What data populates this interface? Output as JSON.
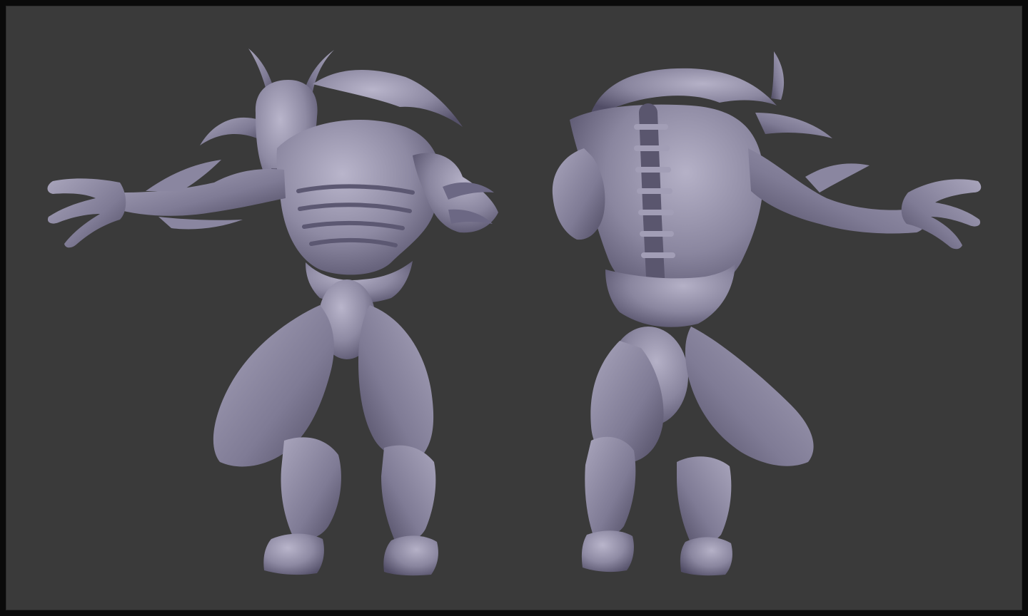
{
  "viewport": {
    "background_color": "#3a3a3a",
    "border_color": "#0a0a0a"
  },
  "model": {
    "material_color": "#8e8aa3",
    "shadow_color": "#4e4a5e",
    "highlight_color": "#b7b3c9",
    "views": [
      {
        "name": "front-view"
      },
      {
        "name": "back-view"
      }
    ]
  }
}
